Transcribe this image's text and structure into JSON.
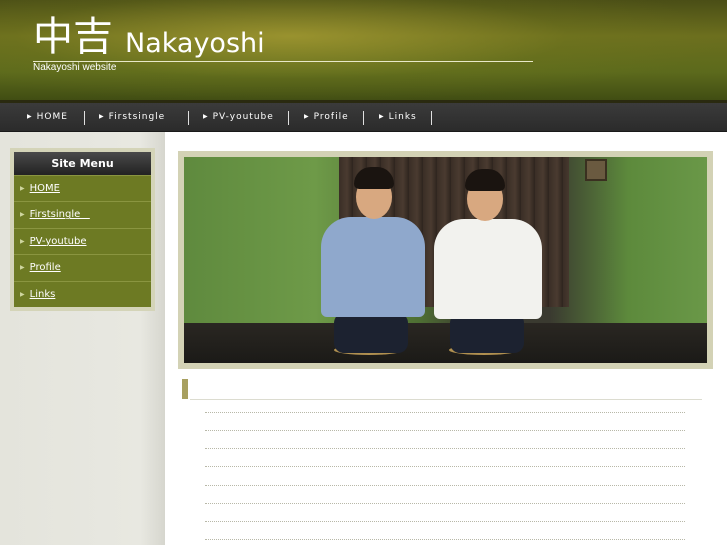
{
  "header": {
    "logo_kanji": "中吉",
    "logo_latin": "Nakayoshi",
    "tagline": "Nakayoshi website",
    "bg_color": "#5c6a1c"
  },
  "nav": {
    "items": [
      {
        "label": "HOME",
        "icon": "triangle-right-icon"
      },
      {
        "label": "Firstsingle",
        "icon": "triangle-right-icon"
      },
      {
        "label": "PV-youtube",
        "icon": "triangle-right-icon"
      },
      {
        "label": "Profile",
        "icon": "triangle-right-icon"
      },
      {
        "label": "Links",
        "icon": "triangle-right-icon"
      }
    ]
  },
  "sidemenu": {
    "title": "Site Menu",
    "item_color": "#6d7a23",
    "items": [
      {
        "label": "HOME",
        "icon": "triangle-right-icon"
      },
      {
        "label": "Firstsingle   ",
        "icon": "triangle-right-icon"
      },
      {
        "label": "PV-youtube",
        "icon": "triangle-right-icon"
      },
      {
        "label": "Profile",
        "icon": "triangle-right-icon"
      },
      {
        "label": "Links",
        "icon": "triangle-right-icon"
      }
    ]
  },
  "main": {
    "hero_image": "two-men-kneeling-photo",
    "section_title": ""
  }
}
